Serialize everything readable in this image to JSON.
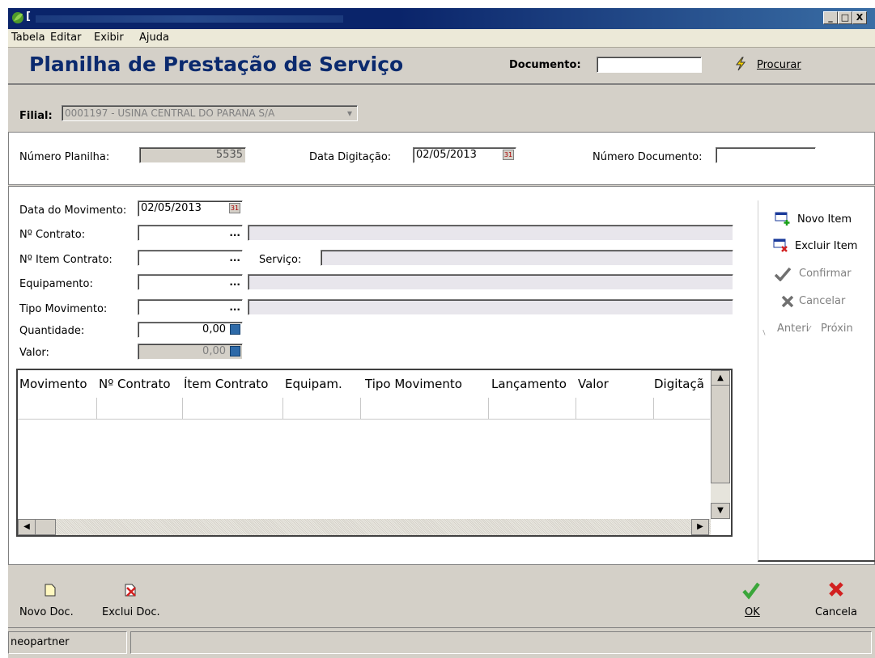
{
  "window": {
    "title": "[",
    "min_label": "_",
    "max_label": "□",
    "close_label": "X"
  },
  "menu": {
    "items": [
      "Tabela",
      "Editar",
      "Exibir",
      "Ajuda"
    ],
    "underline": [
      "T",
      "E",
      "x",
      "A"
    ]
  },
  "header": {
    "title": "Planilha de Prestação de Serviço",
    "documento_label": "Documento:",
    "documento_value": "",
    "procurar_label": "Procurar"
  },
  "filial": {
    "label": "Filial:",
    "value": "0001197 - USINA CENTRAL DO PARANA S/A"
  },
  "planilha": {
    "numero_label": "Número Planilha:",
    "numero_value": "5535",
    "data_digitacao_label": "Data Digitação:",
    "data_digitacao_value": "02/05/2013",
    "numero_documento_label": "Número Documento:",
    "numero_documento_value": ""
  },
  "form": {
    "data_movimento_label": "Data do Movimento:",
    "data_movimento_value": "02/05/2013",
    "contrato_label": "Nº Contrato:",
    "item_contrato_label": "Nº Item Contrato:",
    "servico_label": "Serviço:",
    "equipamento_label": "Equipamento:",
    "tipo_movimento_label": "Tipo Movimento:",
    "quantidade_label": "Quantidade:",
    "quantidade_value": "0,00",
    "valor_label": "Valor:",
    "valor_value": "0,00",
    "ellipsis": "..."
  },
  "side_actions": {
    "novo_item": "Novo Item",
    "excluir_item": "Excluir Item",
    "confirmar": "Confirmar",
    "cancelar": "Cancelar",
    "anterior": "Anteri",
    "proximo": "Próxin"
  },
  "grid": {
    "columns": [
      "Movimento",
      "Nº Contrato",
      "Ítem Contrato",
      "Equipam.",
      "Tipo Movimento",
      "Lançamento",
      "Valor",
      "Digitaçã"
    ]
  },
  "toolbar": {
    "novo_doc": "Novo Doc.",
    "exclui_doc": "Exclui Doc.",
    "ok": "OK",
    "cancela": "Cancela"
  },
  "status": {
    "user": "neopartner"
  },
  "colors": {
    "title_blue": "#0b2a6e",
    "titlebar": "#0a246a",
    "ok_green": "#3aa63a",
    "cancel_red": "#d22020"
  }
}
